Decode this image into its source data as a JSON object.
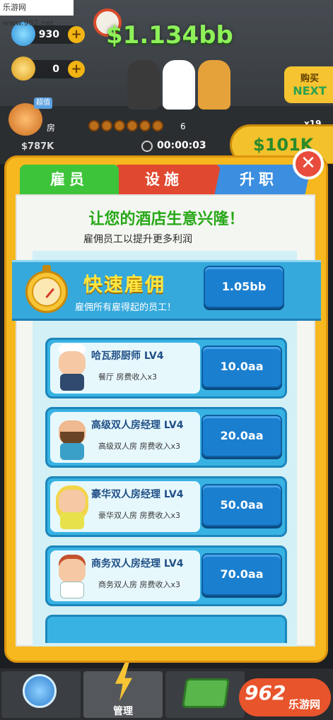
{
  "watermark": "乐游网 www.962.net",
  "hud": {
    "gems": "930",
    "medals": "0",
    "money": "$1.134bb",
    "next_label_top": "购买",
    "next_label_bottom": "NEXT",
    "badge_tag": "超值",
    "room_label": "房",
    "level_number": "6",
    "cash_cap": "$787K",
    "timer": "00:00:03",
    "income": "$101K",
    "multiplier": "x19"
  },
  "tabs": [
    {
      "label": "雇员",
      "color": "#3ec43b",
      "active": true
    },
    {
      "label": "设施",
      "color": "#e0482f",
      "active": false
    },
    {
      "label": "升职",
      "color": "#3b8ee0",
      "active": false
    }
  ],
  "panel": {
    "headline": "让您的酒店生意兴隆！",
    "subline": "雇佣员工以提升更多利润",
    "quick_hire": {
      "title": "快速雇佣",
      "desc": "雇佣所有雇得起的员工！",
      "price": "1.05bb"
    },
    "employees": [
      {
        "title": "哈瓦那厨师 LV4",
        "desc": "餐厅 房费收入x3",
        "price": "10.0aa"
      },
      {
        "title": "高级双人房经理 LV4",
        "desc": "高级双人房 房费收入x3",
        "price": "20.0aa"
      },
      {
        "title": "豪华双人房经理 LV4",
        "desc": "豪华双人房 房费收入x3",
        "price": "50.0aa"
      },
      {
        "title": "商务双人房经理 LV4",
        "desc": "商务双人房 房费收入x3",
        "price": "70.0aa"
      }
    ]
  },
  "close_icon": "close-x",
  "bottom_nav": [
    {
      "label": "",
      "icon": "crown-icon"
    },
    {
      "label": "管理",
      "icon": "lightning-icon",
      "active": true
    },
    {
      "label": "",
      "icon": "cash-icon"
    }
  ],
  "logo": {
    "big": "962",
    "small": "乐游网"
  },
  "colors": {
    "panel_orange": "#f6b81e",
    "quick_blue": "#35a9dc",
    "button_blue": "#1b7fd0",
    "headline_green": "#27a817",
    "title_yellow": "#ffe640"
  }
}
